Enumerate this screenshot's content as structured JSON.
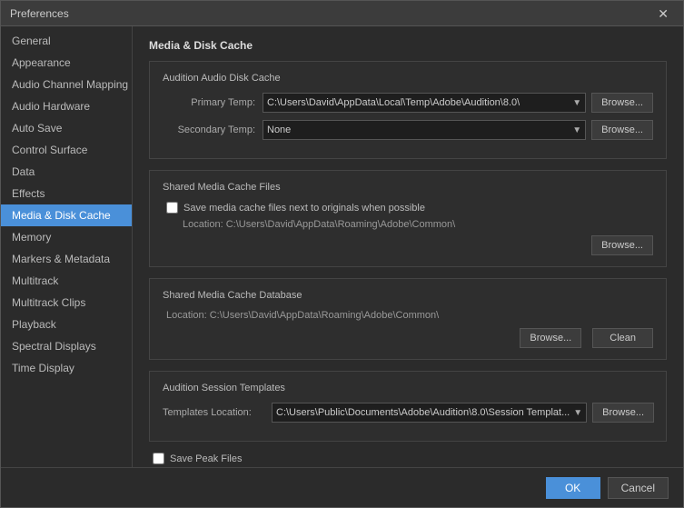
{
  "titlebar": {
    "title": "Preferences",
    "close_label": "✕"
  },
  "sidebar": {
    "items": [
      {
        "label": "General",
        "active": false
      },
      {
        "label": "Appearance",
        "active": false
      },
      {
        "label": "Audio Channel Mapping",
        "active": false
      },
      {
        "label": "Audio Hardware",
        "active": false
      },
      {
        "label": "Auto Save",
        "active": false
      },
      {
        "label": "Control Surface",
        "active": false
      },
      {
        "label": "Data",
        "active": false
      },
      {
        "label": "Effects",
        "active": false
      },
      {
        "label": "Media & Disk Cache",
        "active": true
      },
      {
        "label": "Memory",
        "active": false
      },
      {
        "label": "Markers & Metadata",
        "active": false
      },
      {
        "label": "Multitrack",
        "active": false
      },
      {
        "label": "Multitrack Clips",
        "active": false
      },
      {
        "label": "Playback",
        "active": false
      },
      {
        "label": "Spectral Displays",
        "active": false
      },
      {
        "label": "Time Display",
        "active": false
      }
    ]
  },
  "main": {
    "section_title": "Media & Disk Cache",
    "audition_audio_disk_cache": {
      "title": "Audition Audio Disk Cache",
      "primary_temp_label": "Primary Temp:",
      "primary_temp_value": "C:\\Users\\David\\AppData\\Local\\Temp\\Adobe\\Audition\\8.0\\",
      "secondary_temp_label": "Secondary Temp:",
      "secondary_temp_value": "None",
      "browse_label": "Browse..."
    },
    "shared_media_cache_files": {
      "title": "Shared Media Cache Files",
      "checkbox_label": "Save media cache files next to originals when possible",
      "location_label": "Location: C:\\Users\\David\\AppData\\Roaming\\Adobe\\Common\\",
      "browse_label": "Browse..."
    },
    "shared_media_cache_database": {
      "title": "Shared Media Cache Database",
      "location_label": "Location: C:\\Users\\David\\AppData\\Roaming\\Adobe\\Common\\",
      "browse_label": "Browse...",
      "clean_label": "Clean"
    },
    "audition_session_templates": {
      "title": "Audition Session Templates",
      "templates_location_label": "Templates Location:",
      "templates_location_value": "C:\\Users\\Public\\Documents\\Adobe\\Audition\\8.0\\Session Templat...",
      "browse_label": "Browse..."
    },
    "save_peak_files": {
      "checkbox_label": "Save Peak Files"
    }
  },
  "footer": {
    "ok_label": "OK",
    "cancel_label": "Cancel"
  }
}
